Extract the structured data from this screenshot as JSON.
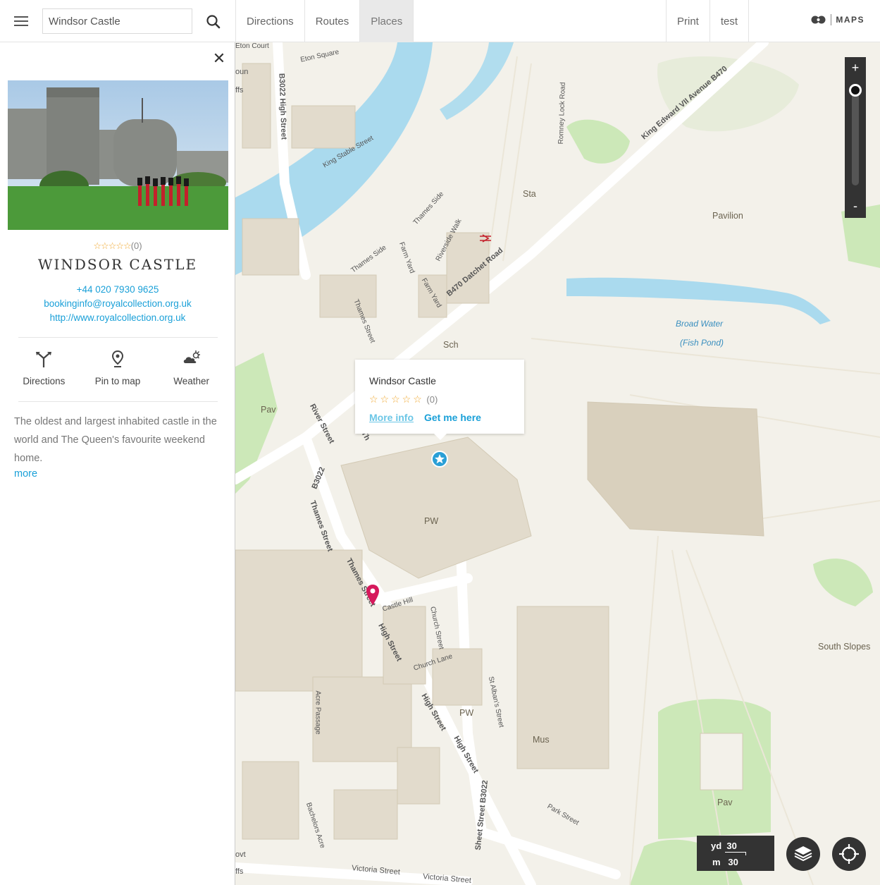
{
  "search": {
    "value": "Windsor Castle"
  },
  "nav": {
    "items": [
      "Directions",
      "Routes",
      "Places"
    ],
    "active": "Places",
    "right_items": [
      "Print",
      "test"
    ]
  },
  "brand": {
    "name": "MAPS"
  },
  "place": {
    "rating_count": "(0)",
    "stars": "☆☆☆☆☆",
    "title": "WINDSOR CASTLE",
    "phone": "+44 020 7930 9625",
    "email": "bookinginfo@royalcollection.org.uk",
    "website": "http://www.royalcollection.org.uk",
    "actions": {
      "directions": "Directions",
      "pin": "Pin to map",
      "weather": "Weather"
    },
    "description": "The oldest and largest inhabited castle in the world and The Queen's favourite weekend home.",
    "more_label": "more"
  },
  "popup": {
    "title": "Windsor Castle",
    "stars": "☆☆☆☆☆",
    "rating_count": "(0)",
    "more_info": "More info",
    "get_me_here": "Get me here"
  },
  "map_controls": {
    "zoom_in": "+",
    "zoom_out": "-"
  },
  "scale": {
    "yd_label": "yd",
    "yd_value": "30",
    "m_label": "m",
    "m_value": "30"
  },
  "map_labels": {
    "sta": "Sta",
    "pavilion": "Pavilion",
    "broad_water": "Broad Water",
    "fish_pond": "(Fish Pond)",
    "sch": "Sch",
    "pav1": "Pav",
    "pw1": "PW",
    "pw2": "PW",
    "mus": "Mus",
    "south_slopes": "South Slopes",
    "pav2": "Pav",
    "eton_court": "Eton Court",
    "eton_square": "Eton Square",
    "high_street_b3022_top": "B3022 High Street",
    "king_stable_street": "King Stable Street",
    "thames_side1": "Thames Side",
    "thames_side2": "Thames Side",
    "farm_yard1": "Farm Yard",
    "farm_yard2": "Farm Yard",
    "riverside_walk": "Riverside Walk",
    "romney_lock_road": "Romney Lock Road",
    "king_edward": "King Edward VII Avenue B470",
    "datchet_road": "B470 Datchet Road",
    "thames_street1": "Thames Street",
    "river_street": "River Street",
    "b3022": "B3022",
    "thames_street2": "Thames Street",
    "thames_street3": "Thames Street",
    "castle_hill": "Castle Hill",
    "church_street": "Church Street",
    "church_lane": "Church Lane",
    "high_street1": "High Street",
    "high_street2": "High Street",
    "high_street3": "High Street",
    "st_albans": "St Alban's Street",
    "acre_passage": "Acre Passage",
    "sheet_street": "Sheet Street B3022",
    "park_street": "Park Street",
    "bachelors_acre": "Bachelors Acre",
    "victoria_street1": "Victoria Street",
    "victoria_street2": "Victoria Street",
    "frag_oun": "oun",
    "frag_ffs": "ffs",
    "frag_ovt": "ovt",
    "frag_ffs2": "ffs",
    "frag_th": "Th"
  },
  "colors": {
    "accent": "#1aa0d8",
    "water": "#aadaee",
    "park": "#cce8b8",
    "building": "#e2dbcc",
    "land": "#f3f1ea",
    "marker_pink": "#d6195c",
    "star": "#f0a830"
  }
}
